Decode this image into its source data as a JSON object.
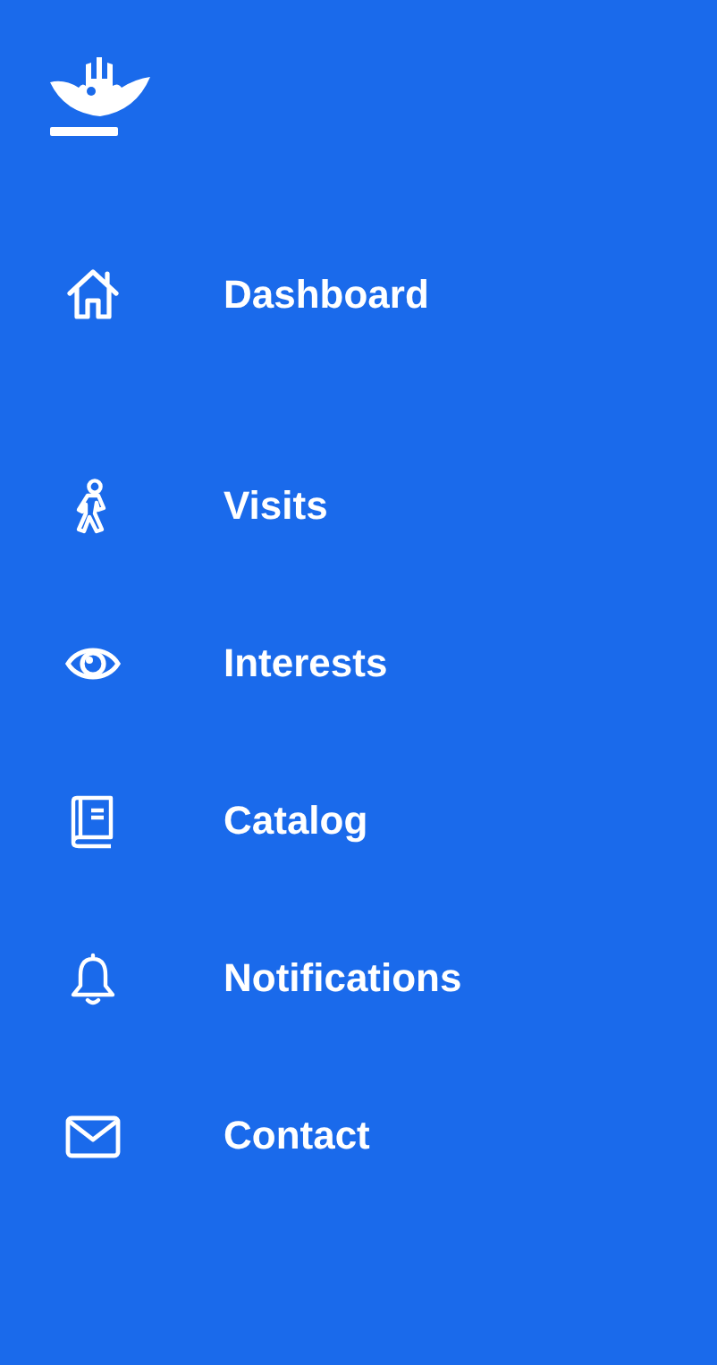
{
  "sidebar": {
    "items": [
      {
        "label": "Dashboard"
      },
      {
        "label": "Visits"
      },
      {
        "label": "Interests"
      },
      {
        "label": "Catalog"
      },
      {
        "label": "Notifications"
      },
      {
        "label": "Contact"
      }
    ]
  }
}
